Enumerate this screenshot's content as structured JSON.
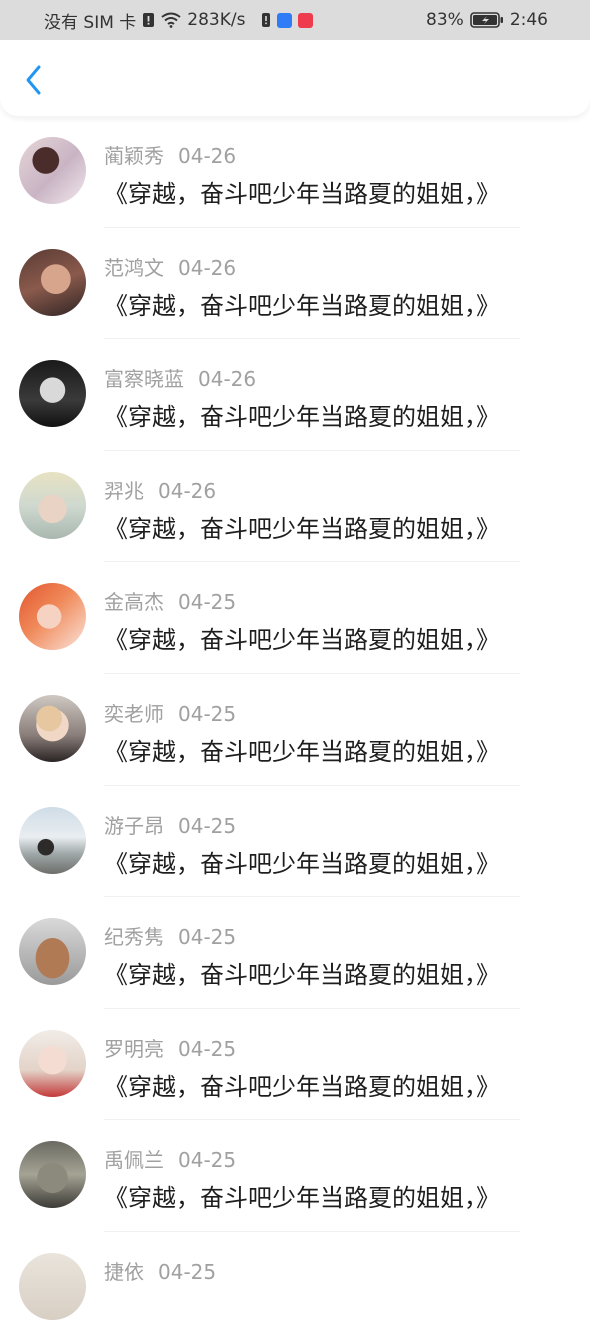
{
  "status_bar": {
    "carrier": "没有 SIM 卡",
    "speed": "283K/s",
    "battery": "83%",
    "time": "2:46"
  },
  "nav": {
    "back_icon": "chevron-left-icon"
  },
  "comments": [
    {
      "name": "蔺颖秀",
      "date": "04-26",
      "text": "《穿越，奋斗吧少年当路夏的姐姐，》"
    },
    {
      "name": "范鸿文",
      "date": "04-26",
      "text": "《穿越，奋斗吧少年当路夏的姐姐，》"
    },
    {
      "name": "富察晓蓝",
      "date": "04-26",
      "text": "《穿越，奋斗吧少年当路夏的姐姐，》"
    },
    {
      "name": "羿兆",
      "date": "04-26",
      "text": "《穿越，奋斗吧少年当路夏的姐姐，》"
    },
    {
      "name": "金高杰",
      "date": "04-25",
      "text": "《穿越，奋斗吧少年当路夏的姐姐，》"
    },
    {
      "name": "奕老师",
      "date": "04-25",
      "text": "《穿越，奋斗吧少年当路夏的姐姐，》"
    },
    {
      "name": "游子昂",
      "date": "04-25",
      "text": "《穿越，奋斗吧少年当路夏的姐姐，》"
    },
    {
      "name": "纪秀隽",
      "date": "04-25",
      "text": "《穿越，奋斗吧少年当路夏的姐姐，》"
    },
    {
      "name": "罗明亮",
      "date": "04-25",
      "text": "《穿越，奋斗吧少年当路夏的姐姐，》"
    },
    {
      "name": "禹佩兰",
      "date": "04-25",
      "text": "《穿越，奋斗吧少年当路夏的姐姐，》"
    },
    {
      "name": "捷依",
      "date": "04-25",
      "text": ""
    }
  ]
}
